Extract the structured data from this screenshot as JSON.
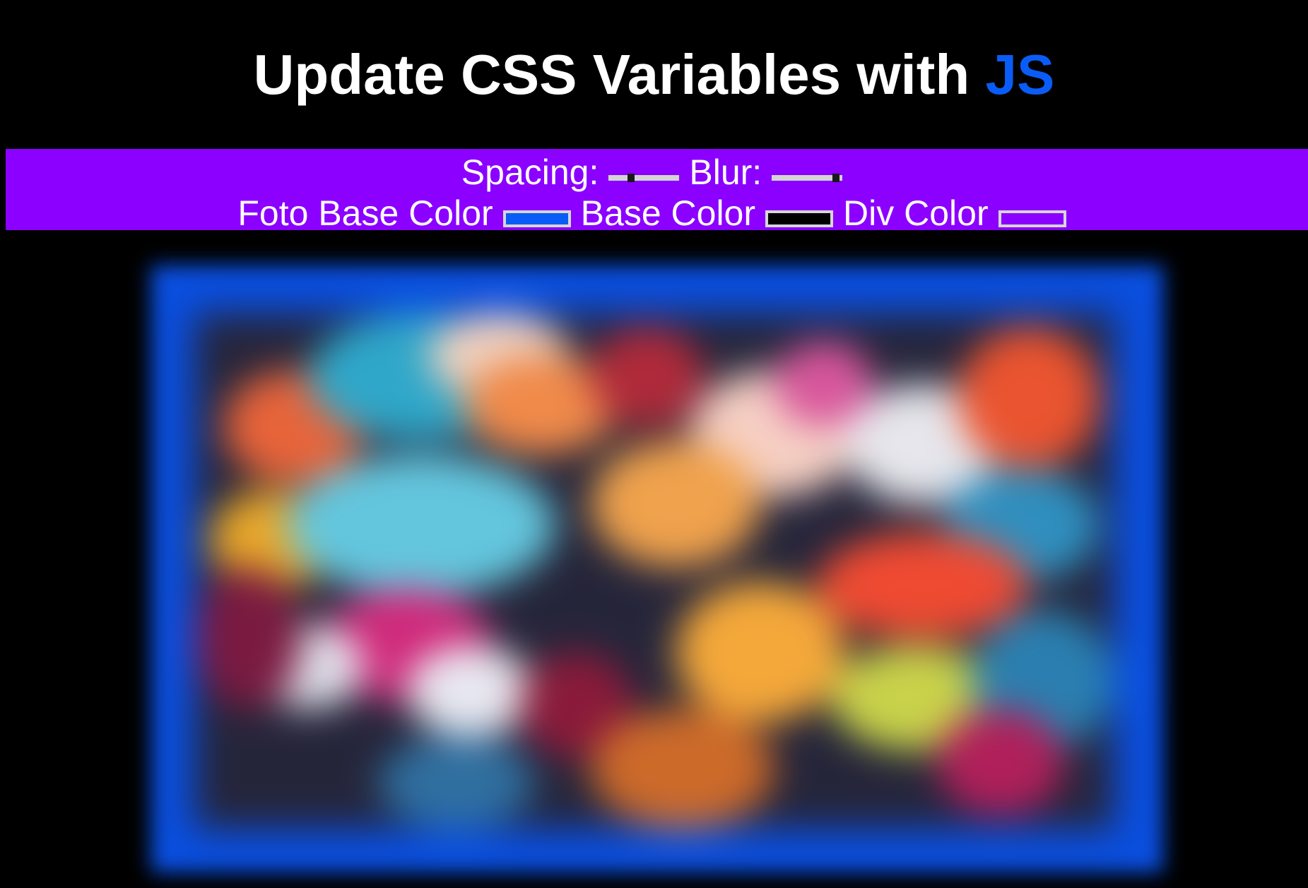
{
  "header": {
    "title_main": "Update CSS Variables with ",
    "title_accent": "JS",
    "accent_color": "#0a5cf6"
  },
  "controls": {
    "background_color": "#8b00ff",
    "spacing_label": "Spacing:",
    "spacing_value_fraction": 0.3,
    "blur_label": "Blur:",
    "blur_value_fraction": 0.95,
    "foto_base_color_label": "Foto Base Color",
    "foto_base_color_value": "#0a5cf6",
    "base_color_label": "Base Color",
    "base_color_value": "#000000",
    "div_color_label": "Div Color",
    "div_color_value": "#8b00ff"
  },
  "image": {
    "icon": "blurred-colorful-photo",
    "frame_color": "#0a4fe0"
  }
}
